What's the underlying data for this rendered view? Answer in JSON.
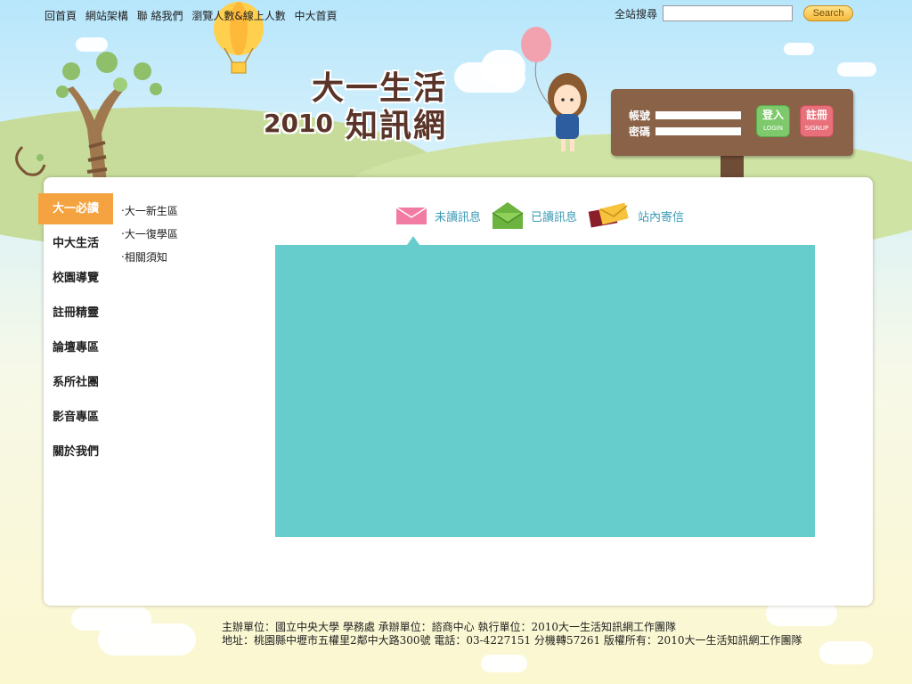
{
  "topnav": {
    "items": [
      "回首頁",
      "網站架構",
      "聯 絡我們",
      "瀏覽人數&線上人數",
      "中大首頁"
    ]
  },
  "search": {
    "label": "全站搜尋",
    "placeholder": "",
    "button": "Search"
  },
  "site_title": {
    "line1": "大一生活",
    "year": "2010",
    "line2": "知訊網"
  },
  "login": {
    "account_label": "帳號",
    "password_label": "密碼",
    "login_button": "登入",
    "login_button_en": "LOGIN",
    "signup_button": "註冊",
    "signup_button_en": "SIGNUP",
    "login_color": "#7dc96b",
    "signup_color": "#e8707a"
  },
  "sidebar": {
    "items": [
      {
        "label": "大一必讀"
      },
      {
        "label": "中大生活"
      },
      {
        "label": "校園導覽"
      },
      {
        "label": "註冊精靈"
      },
      {
        "label": "論壇專區"
      },
      {
        "label": "系所社團"
      },
      {
        "label": "影音專區"
      },
      {
        "label": "關於我們"
      }
    ]
  },
  "subnav": {
    "items": [
      "‧大一新生區",
      "‧大一復學區",
      "‧相關須知"
    ]
  },
  "tabs": [
    {
      "label": "未讀訊息",
      "icon": "pink-envelope-icon"
    },
    {
      "label": "已讀訊息",
      "icon": "green-open-envelope-icon"
    },
    {
      "label": "站內寄信",
      "icon": "send-mail-icon"
    }
  ],
  "colors": {
    "accent_orange": "#f5a340",
    "content_teal": "#66cccc",
    "board_brown": "#8a6248",
    "tab_text": "#3a9ab5"
  },
  "footer": {
    "line1": "主辦單位：國立中央大學 學務處 承辦單位：諮商中心 執行單位：2010大一生活知訊網工作團隊",
    "line2": "地址：桃園縣中壢市五權里2鄰中大路300號 電話：03-4227151 分機轉57261 版權所有：2010大一生活知訊網工作團隊"
  }
}
